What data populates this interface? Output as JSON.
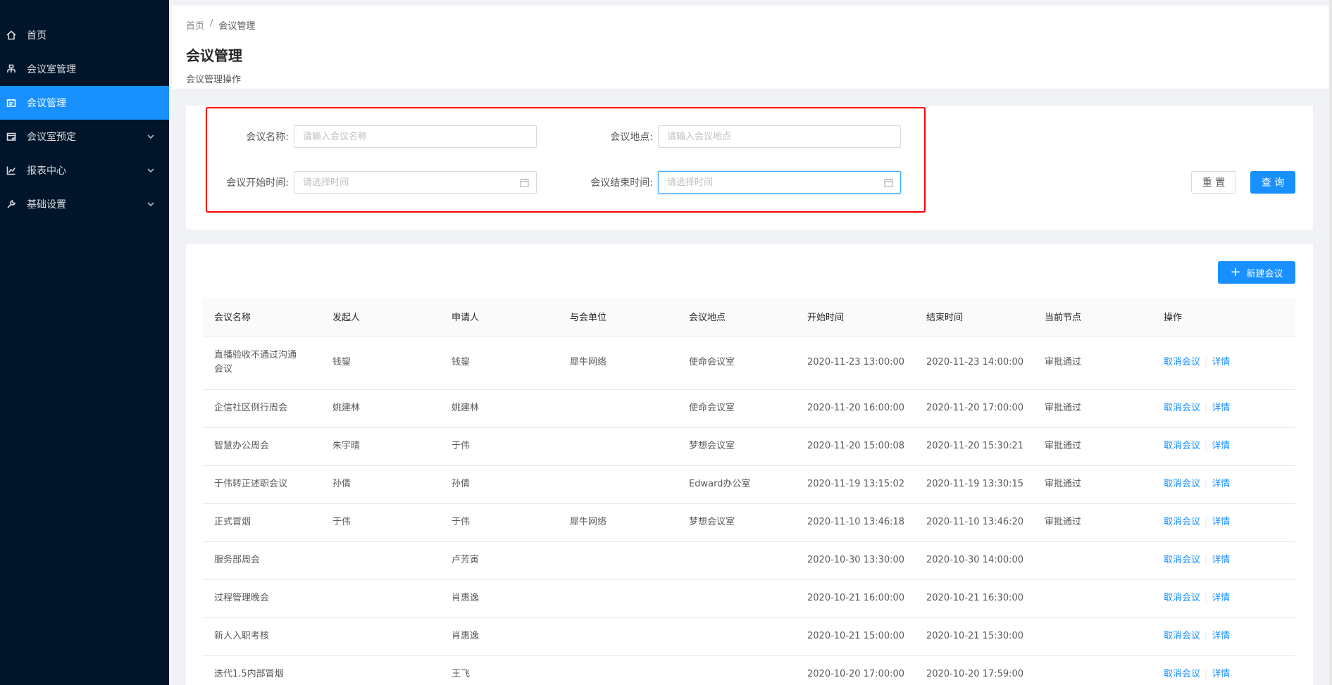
{
  "sidebar": {
    "items": [
      {
        "label": "首页",
        "icon": "home-icon",
        "active": false,
        "has_sub": false
      },
      {
        "label": "会议室管理",
        "icon": "room-icon",
        "active": false,
        "has_sub": false
      },
      {
        "label": "会议管理",
        "icon": "meeting-icon",
        "active": true,
        "has_sub": false
      },
      {
        "label": "会议室预定",
        "icon": "booking-icon",
        "active": false,
        "has_sub": true
      },
      {
        "label": "报表中心",
        "icon": "chart-icon",
        "active": false,
        "has_sub": true
      },
      {
        "label": "基础设置",
        "icon": "wrench-icon",
        "active": false,
        "has_sub": true
      }
    ]
  },
  "header": {
    "breadcrumb": [
      "首页",
      "/",
      "会议管理"
    ],
    "title": "会议管理",
    "subtitle": "会议管理操作"
  },
  "search": {
    "name_label": "会议名称:",
    "name_placeholder": "请输入会议名称",
    "location_label": "会议地点:",
    "location_placeholder": "请输入会议地点",
    "start_label": "会议开始时间:",
    "start_placeholder": "请选择时间",
    "end_label": "会议结束时间:",
    "end_placeholder": "请选择时间",
    "reset_label": "重 置",
    "query_label": "查 询"
  },
  "toolbar": {
    "new_label": "新建会议"
  },
  "table": {
    "columns": [
      "会议名称",
      "发起人",
      "申请人",
      "与会单位",
      "会议地点",
      "开始时间",
      "结束时间",
      "当前节点",
      "操作"
    ],
    "rows": [
      {
        "name": "直播验收不通过沟通会议",
        "initiator": "钱鋆",
        "applicant": "钱鋆",
        "unit": "犀牛网络",
        "location": "使命会议室",
        "start": "2020-11-23 13:00:00",
        "end": "2020-11-23 14:00:00",
        "node": "审批通过"
      },
      {
        "name": "企信社区例行周会",
        "initiator": "姚建林",
        "applicant": "姚建林",
        "unit": "",
        "location": "使命会议室",
        "start": "2020-11-20 16:00:00",
        "end": "2020-11-20 17:00:00",
        "node": "审批通过"
      },
      {
        "name": "智慧办公周会",
        "initiator": "朱宇晴",
        "applicant": "于伟",
        "unit": "",
        "location": "梦想会议室",
        "start": "2020-11-20 15:00:08",
        "end": "2020-11-20 15:30:21",
        "node": "审批通过"
      },
      {
        "name": "于伟转正述职会议",
        "initiator": "孙倩",
        "applicant": "孙倩",
        "unit": "",
        "location": "Edward办公室",
        "start": "2020-11-19 13:15:02",
        "end": "2020-11-19 13:30:15",
        "node": "审批通过"
      },
      {
        "name": "正式冒烟",
        "initiator": "于伟",
        "applicant": "于伟",
        "unit": "犀牛网络",
        "location": "梦想会议室",
        "start": "2020-11-10 13:46:18",
        "end": "2020-11-10 13:46:20",
        "node": "审批通过"
      },
      {
        "name": "服务部周会",
        "initiator": "",
        "applicant": "卢芳寅",
        "unit": "",
        "location": "",
        "start": "2020-10-30 13:30:00",
        "end": "2020-10-30 14:00:00",
        "node": ""
      },
      {
        "name": "过程管理晚会",
        "initiator": "",
        "applicant": "肖惠逸",
        "unit": "",
        "location": "",
        "start": "2020-10-21 16:00:00",
        "end": "2020-10-21 16:30:00",
        "node": ""
      },
      {
        "name": "新人入职考核",
        "initiator": "",
        "applicant": "肖惠逸",
        "unit": "",
        "location": "",
        "start": "2020-10-21 15:00:00",
        "end": "2020-10-21 15:30:00",
        "node": ""
      },
      {
        "name": "迭代1.5内部冒烟",
        "initiator": "",
        "applicant": "王飞",
        "unit": "",
        "location": "",
        "start": "2020-10-20 17:00:00",
        "end": "2020-10-20 17:59:00",
        "node": ""
      }
    ],
    "action_cancel": "取消会议",
    "action_detail": "详情"
  },
  "colors": {
    "primary": "#1890ff",
    "sidebar_bg": "#001529",
    "highlight_border": "#ff0000"
  }
}
